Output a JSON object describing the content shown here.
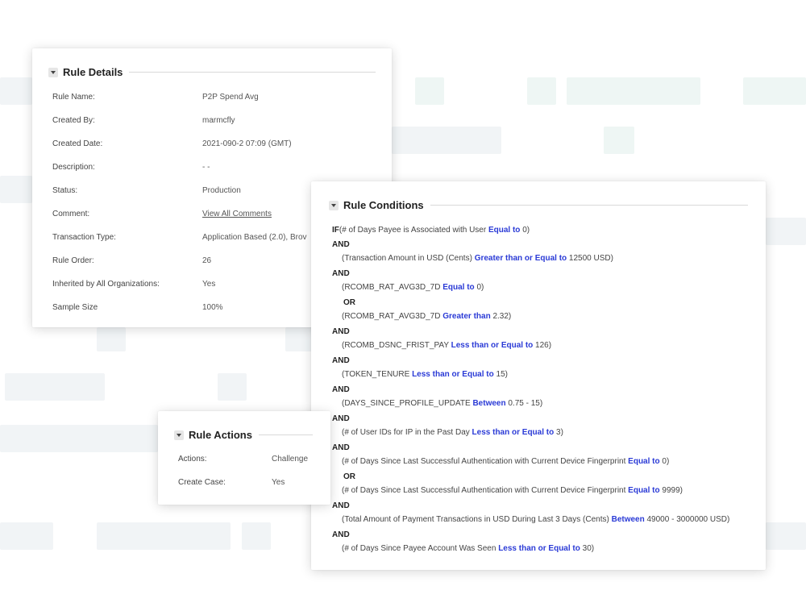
{
  "rule_details": {
    "title": "Rule Details",
    "rows": [
      {
        "label": "Rule Name:",
        "value": "P2P Spend Avg"
      },
      {
        "label": "Created By:",
        "value": "marmcfly"
      },
      {
        "label": "Created Date:",
        "value": "2021-090-2 07:09 (GMT)"
      },
      {
        "label": "Description:",
        "value": "- -"
      },
      {
        "label": "Status:",
        "value": "Production"
      },
      {
        "label": "Comment:",
        "value": "View All Comments",
        "link": true
      },
      {
        "label": "Transaction Type:",
        "value": "Application Based (2.0), Brov"
      },
      {
        "label": "Rule Order:",
        "value": "26"
      },
      {
        "label": "Inherited by All Organizations:",
        "value": "Yes"
      },
      {
        "label": "Sample Size",
        "value": "100%"
      }
    ]
  },
  "rule_actions": {
    "title": "Rule Actions",
    "rows": [
      {
        "label": "Actions:",
        "value": "Challenge"
      },
      {
        "label": "Create Case:",
        "value": "Yes"
      }
    ]
  },
  "rule_conditions": {
    "title": "Rule Conditions",
    "lines": [
      {
        "kw": "IF",
        "pre": "(# of Days Payee is Associated with User ",
        "op": "Equal to",
        "post": " 0)"
      },
      {
        "kw": "AND"
      },
      {
        "pre": "(Transaction Amount in USD (Cents) ",
        "op": "Greater than or Equal to",
        "post": " 12500 USD)"
      },
      {
        "kw": "AND"
      },
      {
        "pre": "(RCOMB_RAT_AVG3D_7D ",
        "op": "Equal to",
        "post": " 0)"
      },
      {
        "kw": "OR",
        "indent": true
      },
      {
        "pre": "(RCOMB_RAT_AVG3D_7D ",
        "op": "Greater than",
        "post": " 2.32)"
      },
      {
        "kw": "AND"
      },
      {
        "pre": "(RCOMB_DSNC_FRIST_PAY ",
        "op": "Less than or Equal to",
        "post": " 126)"
      },
      {
        "kw": "AND"
      },
      {
        "pre": "(TOKEN_TENURE ",
        "op": "Less than or Equal to",
        "post": " 15)"
      },
      {
        "kw": "AND"
      },
      {
        "pre": "(DAYS_SINCE_PROFILE_UPDATE ",
        "op": "Between",
        "post": " 0.75 - 15)"
      },
      {
        "kw": "AND"
      },
      {
        "pre": "(# of User IDs for IP in the Past Day ",
        "op": "Less than or Equal to",
        "post": " 3)"
      },
      {
        "kw": "AND"
      },
      {
        "pre": "(# of Days Since Last Successful Authentication with Current Device Fingerprint ",
        "op": "Equal to",
        "post": " 0)"
      },
      {
        "kw": "OR",
        "indent": true
      },
      {
        "pre": "(# of Days Since Last Successful Authentication with Current Device Fingerprint ",
        "op": "Equal to",
        "post": " 9999)"
      },
      {
        "kw": "AND"
      },
      {
        "pre": "(Total Amount of Payment Transactions in USD During Last 3 Days (Cents) ",
        "op": "Between",
        "post": " 49000 - 3000000 USD)"
      },
      {
        "kw": "AND"
      },
      {
        "pre": "(# of Days Since Payee Account Was Seen ",
        "op": "Less than or Equal to",
        "post": " 30)"
      }
    ]
  },
  "colors": {
    "operator": "#2a3ad6",
    "background_block": "#f1f4f6",
    "background_block_alt": "#eef6f4"
  }
}
